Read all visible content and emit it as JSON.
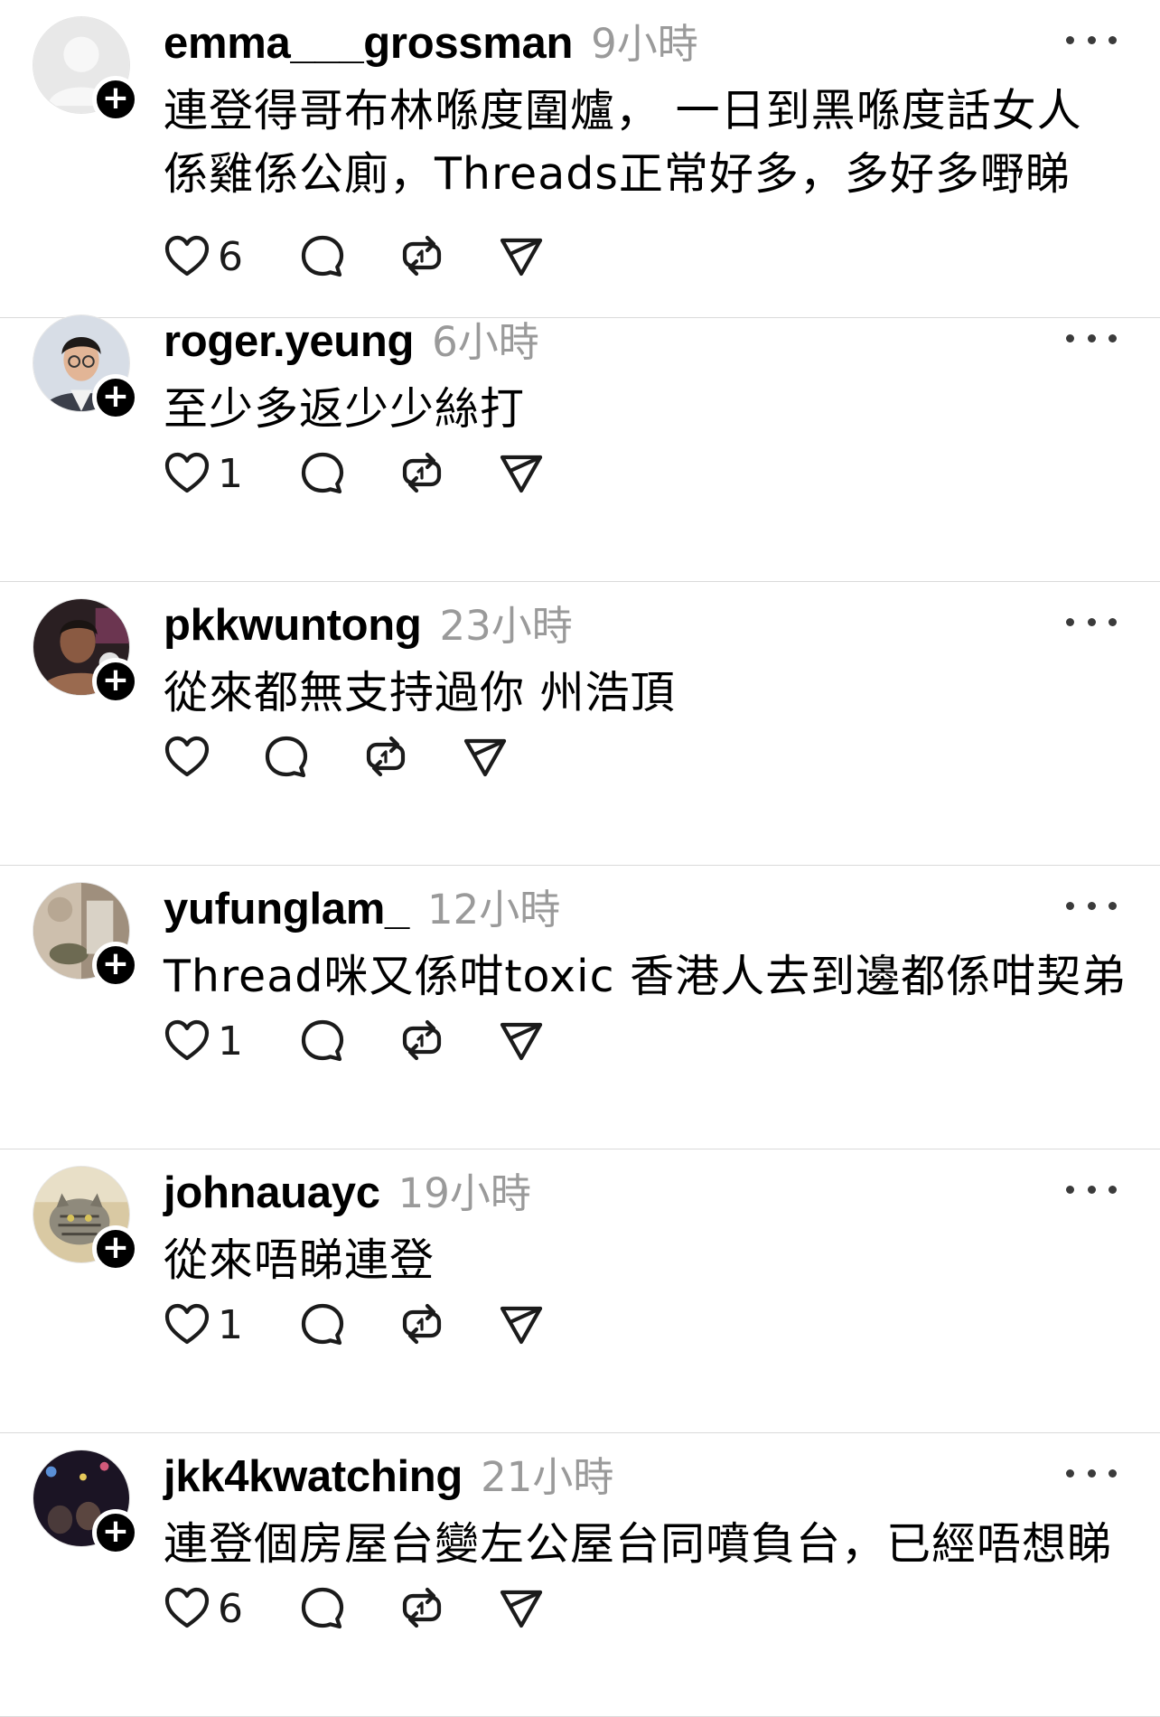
{
  "posts": [
    {
      "username": "emma___grossman",
      "time": "9小時",
      "text": "連登得哥布林喺度圍爐， 一日到黑喺度話女人係雞係公廁，Threads正常好多，多好多嘢睇",
      "likes": "6",
      "avatar_icon": "default-user-avatar-icon"
    },
    {
      "username": "roger.yeung",
      "time": "6小時",
      "text": "至少多返少少絲打",
      "likes": "1",
      "avatar_icon": "man-with-glasses-avatar"
    },
    {
      "username": "pkkwuntong",
      "time": "23小時",
      "text": "從來都無支持過你 州浩頂",
      "likes": "",
      "avatar_icon": "boxer-avatar"
    },
    {
      "username": "yufunglam_",
      "time": "12小時",
      "text": "Thread咪又係咁toxic 香港人去到邊都係咁契弟",
      "likes": "1",
      "avatar_icon": "blurred-photo-avatar"
    },
    {
      "username": "johnauayc",
      "time": "19小時",
      "text": "從來唔睇連登",
      "likes": "1",
      "avatar_icon": "tabby-cat-avatar"
    },
    {
      "username": "jkk4kwatching",
      "time": "21小時",
      "text": "連登個房屋台變左公屋台同噴負台，已經唔想睇",
      "likes": "6",
      "avatar_icon": "concert-crowd-avatar"
    }
  ],
  "icons": {
    "like": "heart-icon",
    "comment": "comment-bubble-icon",
    "repost": "repost-icon",
    "share": "share-paper-plane-icon",
    "more": "more-options-icon",
    "follow": "follow-plus-icon"
  },
  "follow_symbol": "+",
  "colors": {
    "text": "#000000",
    "muted": "#9a9a9a",
    "divider": "#dadada"
  }
}
